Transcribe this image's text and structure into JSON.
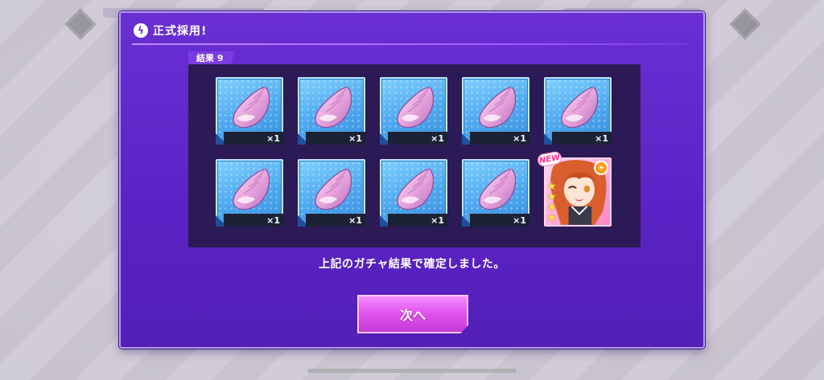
{
  "dialog": {
    "title": "正式採用!",
    "results_label": "結果 9",
    "confirm_message": "上記のガチャ結果で確定しました。",
    "next_button": "次へ"
  },
  "items": [
    {
      "type": "shell",
      "count": "×1"
    },
    {
      "type": "shell",
      "count": "×1"
    },
    {
      "type": "shell",
      "count": "×1"
    },
    {
      "type": "shell",
      "count": "×1"
    },
    {
      "type": "shell",
      "count": "×1"
    },
    {
      "type": "shell",
      "count": "×1"
    },
    {
      "type": "shell",
      "count": "×1"
    },
    {
      "type": "shell",
      "count": "×1"
    },
    {
      "type": "shell",
      "count": "×1"
    },
    {
      "type": "character",
      "badge": "NEW",
      "stars": 4
    }
  ],
  "colors": {
    "dialog_bg": "#6a2fd2",
    "panel_bg": "#2c1a56",
    "item_card": "#4ea8ef",
    "button": "#e255ef"
  }
}
